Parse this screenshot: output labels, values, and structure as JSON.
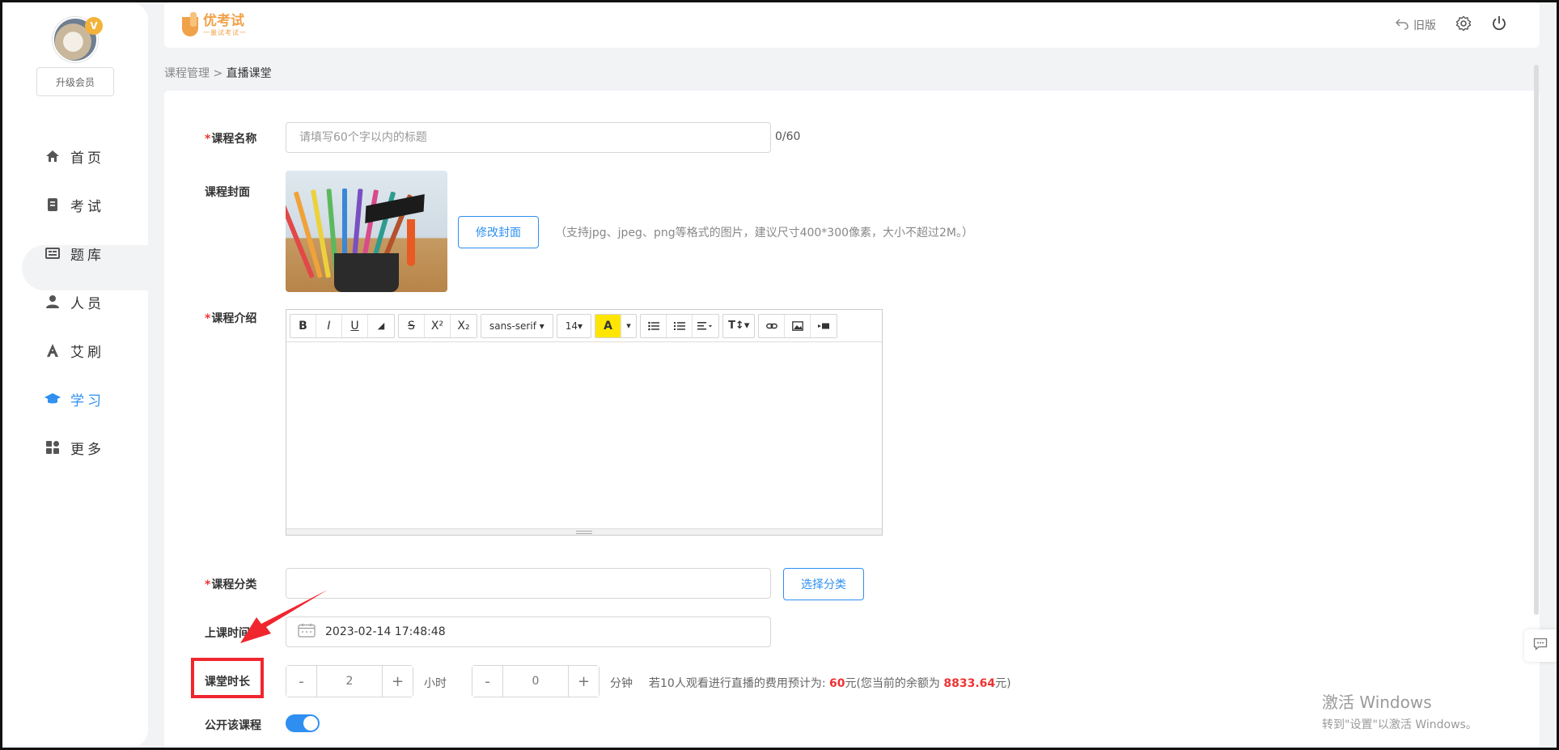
{
  "app": {
    "logo_text": "优考试",
    "logo_sub": "一量试考试一",
    "old_version_label": "旧版"
  },
  "sidebar": {
    "upgrade_label": "升级会员",
    "items": [
      {
        "label": "首页",
        "icon": "home-icon"
      },
      {
        "label": "考试",
        "icon": "exam-icon"
      },
      {
        "label": "题库",
        "icon": "question-bank-icon"
      },
      {
        "label": "人员",
        "icon": "user-icon"
      },
      {
        "label": "艾刷",
        "icon": "ai-brush-icon"
      },
      {
        "label": "学习",
        "icon": "graduation-cap-icon",
        "active": true
      },
      {
        "label": "更多",
        "icon": "grid-icon"
      }
    ]
  },
  "breadcrumb": {
    "parent": "课程管理",
    "separator": ">",
    "current": "直播课堂"
  },
  "form": {
    "required_mark": "*",
    "course_name": {
      "label": "课程名称",
      "value": "",
      "placeholder": "请填写60个字以内的标题",
      "counter": "0/60"
    },
    "course_cover": {
      "label": "课程封面",
      "change_button": "修改封面",
      "hint": "（支持jpg、jpeg、png等格式的图片，建议尺寸400*300像素，大小不超过2M。）"
    },
    "course_intro": {
      "label": "课程介绍",
      "toolbar": {
        "bold": "B",
        "italic": "I",
        "underline": "U",
        "eraser": "◢",
        "strike": "S",
        "superscript": "X²",
        "subscript": "X₂",
        "font_family": "sans-serif ▾",
        "font_size": "14▾",
        "font_color": "A",
        "dropdown": "▾",
        "line_height": "T↕▾"
      }
    },
    "course_category": {
      "label": "课程分类",
      "value": "",
      "select_button": "选择分类"
    },
    "class_time": {
      "label": "上课时间",
      "value": "2023-02-14 17:48:48"
    },
    "duration": {
      "label": "课堂时长",
      "hours": "2",
      "hours_unit": "小时",
      "minutes": "0",
      "minutes_unit": "分钟",
      "minus": "-",
      "plus": "+",
      "cost_prefix": "若10人观看进行直播的费用预计为:",
      "cost_amount": "60",
      "cost_mid": "元(您当前的余额为",
      "balance": "8833.64",
      "cost_suffix": "元)"
    },
    "public_course": {
      "label": "公开该课程",
      "enabled": true
    }
  },
  "watermark": {
    "line1": "激活 Windows",
    "line2": "转到\"设置\"以激活 Windows。"
  },
  "colors": {
    "accent": "#2e8ff0",
    "required": "#e33333",
    "brand": "#f0a24a",
    "highlight": "#f0262f"
  }
}
